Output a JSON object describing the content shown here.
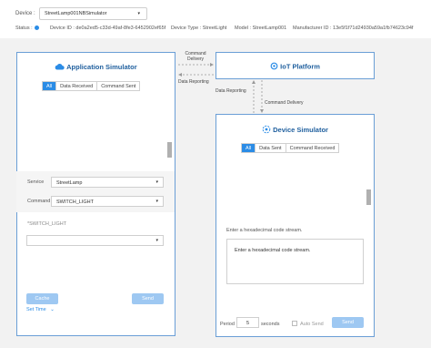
{
  "header": {
    "device_label": "Device :",
    "device_value": "StreetLamp001NBSimulator",
    "status_label": "Status :",
    "device_id": "Device ID : de0a2ed5-c33d-49af-8fe3-6452902ef65f",
    "device_type": "Device Type : StreetLight",
    "model": "Model : StreetLamp001",
    "manufacturer_id": "Manufacturer ID : 13e5f1f71d24930a59a1fb74623c94f"
  },
  "app_sim": {
    "title": "Application Simulator",
    "tabs": [
      "All",
      "Data Received",
      "Command Sent"
    ],
    "service_label": "Service",
    "service_value": "StreetLamp",
    "command_label": "Command",
    "command_value": "SWITCH_LIGHT",
    "param_label": "*SWITCH_LIGHT",
    "param_value": "",
    "cache_label": "Cache",
    "send_label": "Send",
    "set_time_label": "Set Time"
  },
  "iot_platform": {
    "title": "IoT Platform"
  },
  "flow": {
    "command_delivery_top": "Command\nDelivery",
    "data_reporting_top": "Data Reporting",
    "data_reporting_right": "Data Reporting",
    "command_delivery_right": "Command Delivery"
  },
  "device_sim": {
    "title": "Device Simulator",
    "tabs": [
      "All",
      "Data Sent",
      "Command Received"
    ],
    "input_label": "Enter a hexadecimal code stream.",
    "input_placeholder": "Enter a hexadecimal code stream.",
    "period_label": "Period",
    "period_value": "5",
    "seconds_label": "seconds",
    "auto_send_label": "Auto Send",
    "send_label": "Send"
  },
  "colors": {
    "accent": "#2b8ce6",
    "panel_border": "#6a9ed6",
    "button_disabled": "#9ec8f2"
  }
}
